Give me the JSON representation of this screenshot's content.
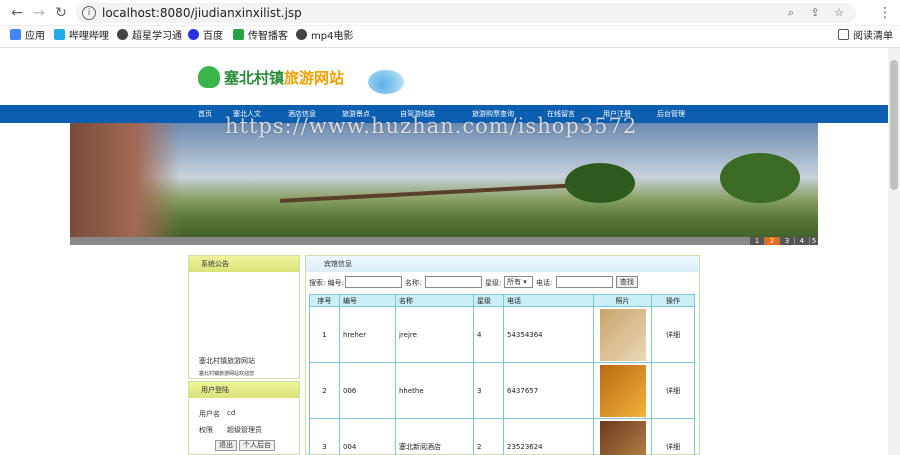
{
  "browser": {
    "url": "localhost:8080/jiudianxinxilist.jsp",
    "bookmarks": [
      {
        "label": "应用",
        "color": "#4285f4"
      },
      {
        "label": "哔哩哔哩",
        "color": "#23ade5"
      },
      {
        "label": "超星学习通",
        "color": "#444444"
      },
      {
        "label": "百度",
        "color": "#2932e1"
      },
      {
        "label": "传智播客",
        "color": "#2aa144"
      },
      {
        "label": "mp4电影",
        "color": "#444444"
      }
    ],
    "reading_list": "阅读清单"
  },
  "site": {
    "title_part1": "塞北村镇",
    "title_part2": "旅游网站",
    "menu": [
      "首页",
      "塞北人文",
      "酒店信息",
      "旅游景点",
      "自驾游线路",
      "旅游购票查询",
      "在线留言",
      "用户注册",
      "后台管理"
    ],
    "watermark": "https://www.huzhan.com/ishop3572",
    "pager": [
      "1",
      "2",
      "3",
      "4",
      "5"
    ],
    "pager_active": 1
  },
  "sidebar": {
    "notice_title": "系统公告",
    "notice_lines": [
      "塞北村镇旅游网站",
      "塞北村镇旅游网站欢迎您"
    ],
    "login_title": "用户登陆",
    "username_label": "用户名",
    "username_value": "cd",
    "role_label": "权限",
    "role_value": "超级管理员",
    "logout_button": "退出",
    "profile_button": "个人后台"
  },
  "main": {
    "title": "宾馆信息",
    "search": {
      "prefix": "搜索: 编号:",
      "name_label": "名称:",
      "level_label": "星级:",
      "level_value": "所有",
      "phone_label": "电话:",
      "find_button": "查找"
    },
    "columns": [
      "序号",
      "编号",
      "名称",
      "星级",
      "电话",
      "照片",
      "操作"
    ],
    "rows": [
      {
        "no": "1",
        "code": "hreher",
        "name": "jrejre",
        "level": "4",
        "phone": "54354364",
        "photo_colors": [
          "#c9a46a",
          "#e9d9b8"
        ],
        "action": "详细"
      },
      {
        "no": "2",
        "code": "006",
        "name": "hhethe",
        "level": "3",
        "phone": "6437657",
        "photo_colors": [
          "#b86a12",
          "#f2b23a"
        ],
        "action": "详细"
      },
      {
        "no": "3",
        "code": "004",
        "name": "塞北新阅酒店",
        "level": "2",
        "phone": "23523624",
        "photo_colors": [
          "#6a3b1e",
          "#c08a4a"
        ],
        "action": "详细"
      }
    ]
  }
}
